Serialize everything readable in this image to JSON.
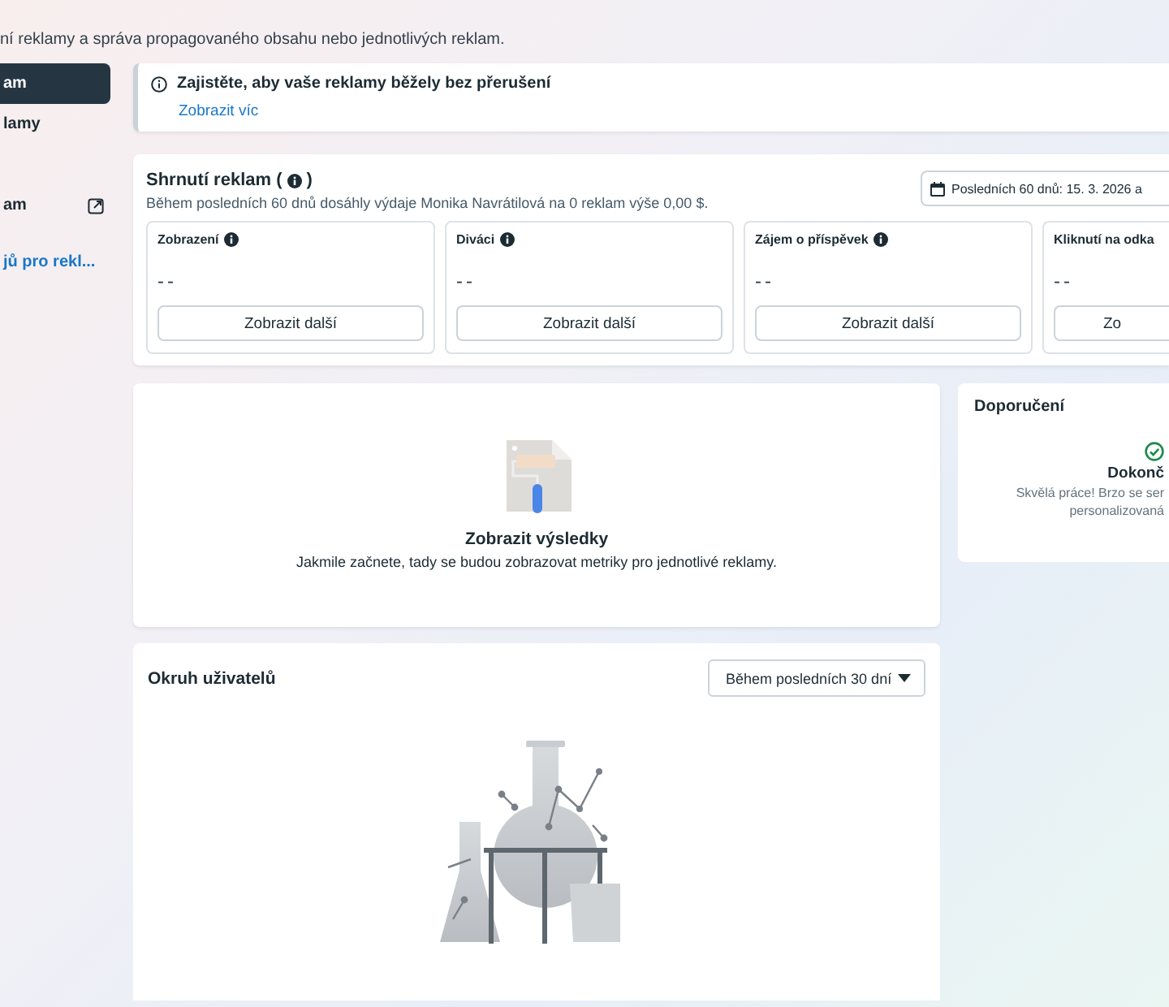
{
  "subtitle": "ní reklamy a správa propagovaného obsahu nebo jednotlivých reklam.",
  "sidebar": {
    "items": [
      {
        "label": "am",
        "selected": true,
        "kind": "item"
      },
      {
        "label": "lamy",
        "selected": false,
        "kind": "item"
      },
      {
        "label": "am",
        "selected": false,
        "kind": "external"
      },
      {
        "label": "jů pro rekl...",
        "selected": false,
        "kind": "link"
      }
    ]
  },
  "banner": {
    "title": "Zajistěte, aby vaše reklamy běžely bez přerušení",
    "link": "Zobrazit víc"
  },
  "summary": {
    "title": "Shrnutí reklam (",
    "title_end": ")",
    "description": "Během posledních 60 dnů dosáhly výdaje Monika Navrátilová na 0 reklam výše 0,00 $.",
    "date_range": "Posledních 60 dnů: 15. 3. 2026 a",
    "metrics": [
      {
        "label": "Zobrazení",
        "info": true,
        "value": "--",
        "button": "Zobrazit další"
      },
      {
        "label": "Diváci",
        "info": true,
        "value": "--",
        "button": "Zobrazit další"
      },
      {
        "label": "Zájem o příspěvek",
        "info": true,
        "value": "--",
        "button": "Zobrazit další"
      },
      {
        "label": "Kliknutí na odka",
        "info": false,
        "value": "--",
        "button": "Zo"
      }
    ]
  },
  "results": {
    "title": "Zobrazit výsledky",
    "text": "Jakmile začnete, tady se budou zobrazovat metriky pro jednotlivé reklamy."
  },
  "recommendations": {
    "title": "Doporučení",
    "status": "Dokonč",
    "lines": [
      "Skvělá práce! Brzo se ser",
      "personalizovaná"
    ]
  },
  "audience": {
    "title": "Okruh uživatelů",
    "period": "Během posledních 30 dní"
  }
}
